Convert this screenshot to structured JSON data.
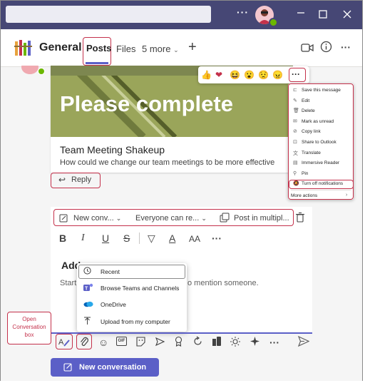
{
  "header": {
    "channel_name": "General",
    "tabs": [
      "Posts",
      "Files",
      "5 more"
    ],
    "add_tab": "+",
    "more": "···"
  },
  "titlebar": {
    "more": "···"
  },
  "post": {
    "banner_text": "Please complete",
    "title": "Team Meeting Shakeup",
    "subtitle": "How could we change our team meetings to be more effective",
    "reply_label": "Reply"
  },
  "reactions": [
    "👍",
    "❤",
    "😆",
    "😮",
    "😟",
    "😠"
  ],
  "menu": {
    "items": [
      "Save this message",
      "Edit",
      "Delete",
      "Mark as unread",
      "Copy link",
      "Share to Outlook",
      "Translate",
      "Immersive Reader",
      "Pin",
      "Turn off notifications",
      "More actions"
    ],
    "icons": [
      "bookmark-icon",
      "pencil-icon",
      "trash-icon",
      "unread-icon",
      "link-icon",
      "outlook-icon",
      "translate-icon",
      "immersive-reader-icon",
      "pin-icon",
      "bell-off-icon",
      "chevron-right-icon"
    ]
  },
  "compose": {
    "post_type": "New conv...",
    "audience": "Everyone can re...",
    "post_in_multiple": "Post in multipl...",
    "placeholder_title": "Add",
    "placeholder_body_left": "Start",
    "placeholder_body_right": "o mention someone.",
    "format_buttons": [
      "B",
      "I",
      "U",
      "S",
      "▽",
      "A",
      "AA",
      "···"
    ]
  },
  "attach_menu": {
    "items": [
      "Recent",
      "Browse Teams and Channels",
      "OneDrive",
      "Upload from my computer"
    ]
  },
  "callout": {
    "text": "Open Conversation box"
  },
  "new_conversation_button": "New conversation",
  "colors": {
    "titlebar": "#464775",
    "accent": "#5b5fc7",
    "highlight": "#c4314b",
    "banner": "#9aa55a"
  }
}
